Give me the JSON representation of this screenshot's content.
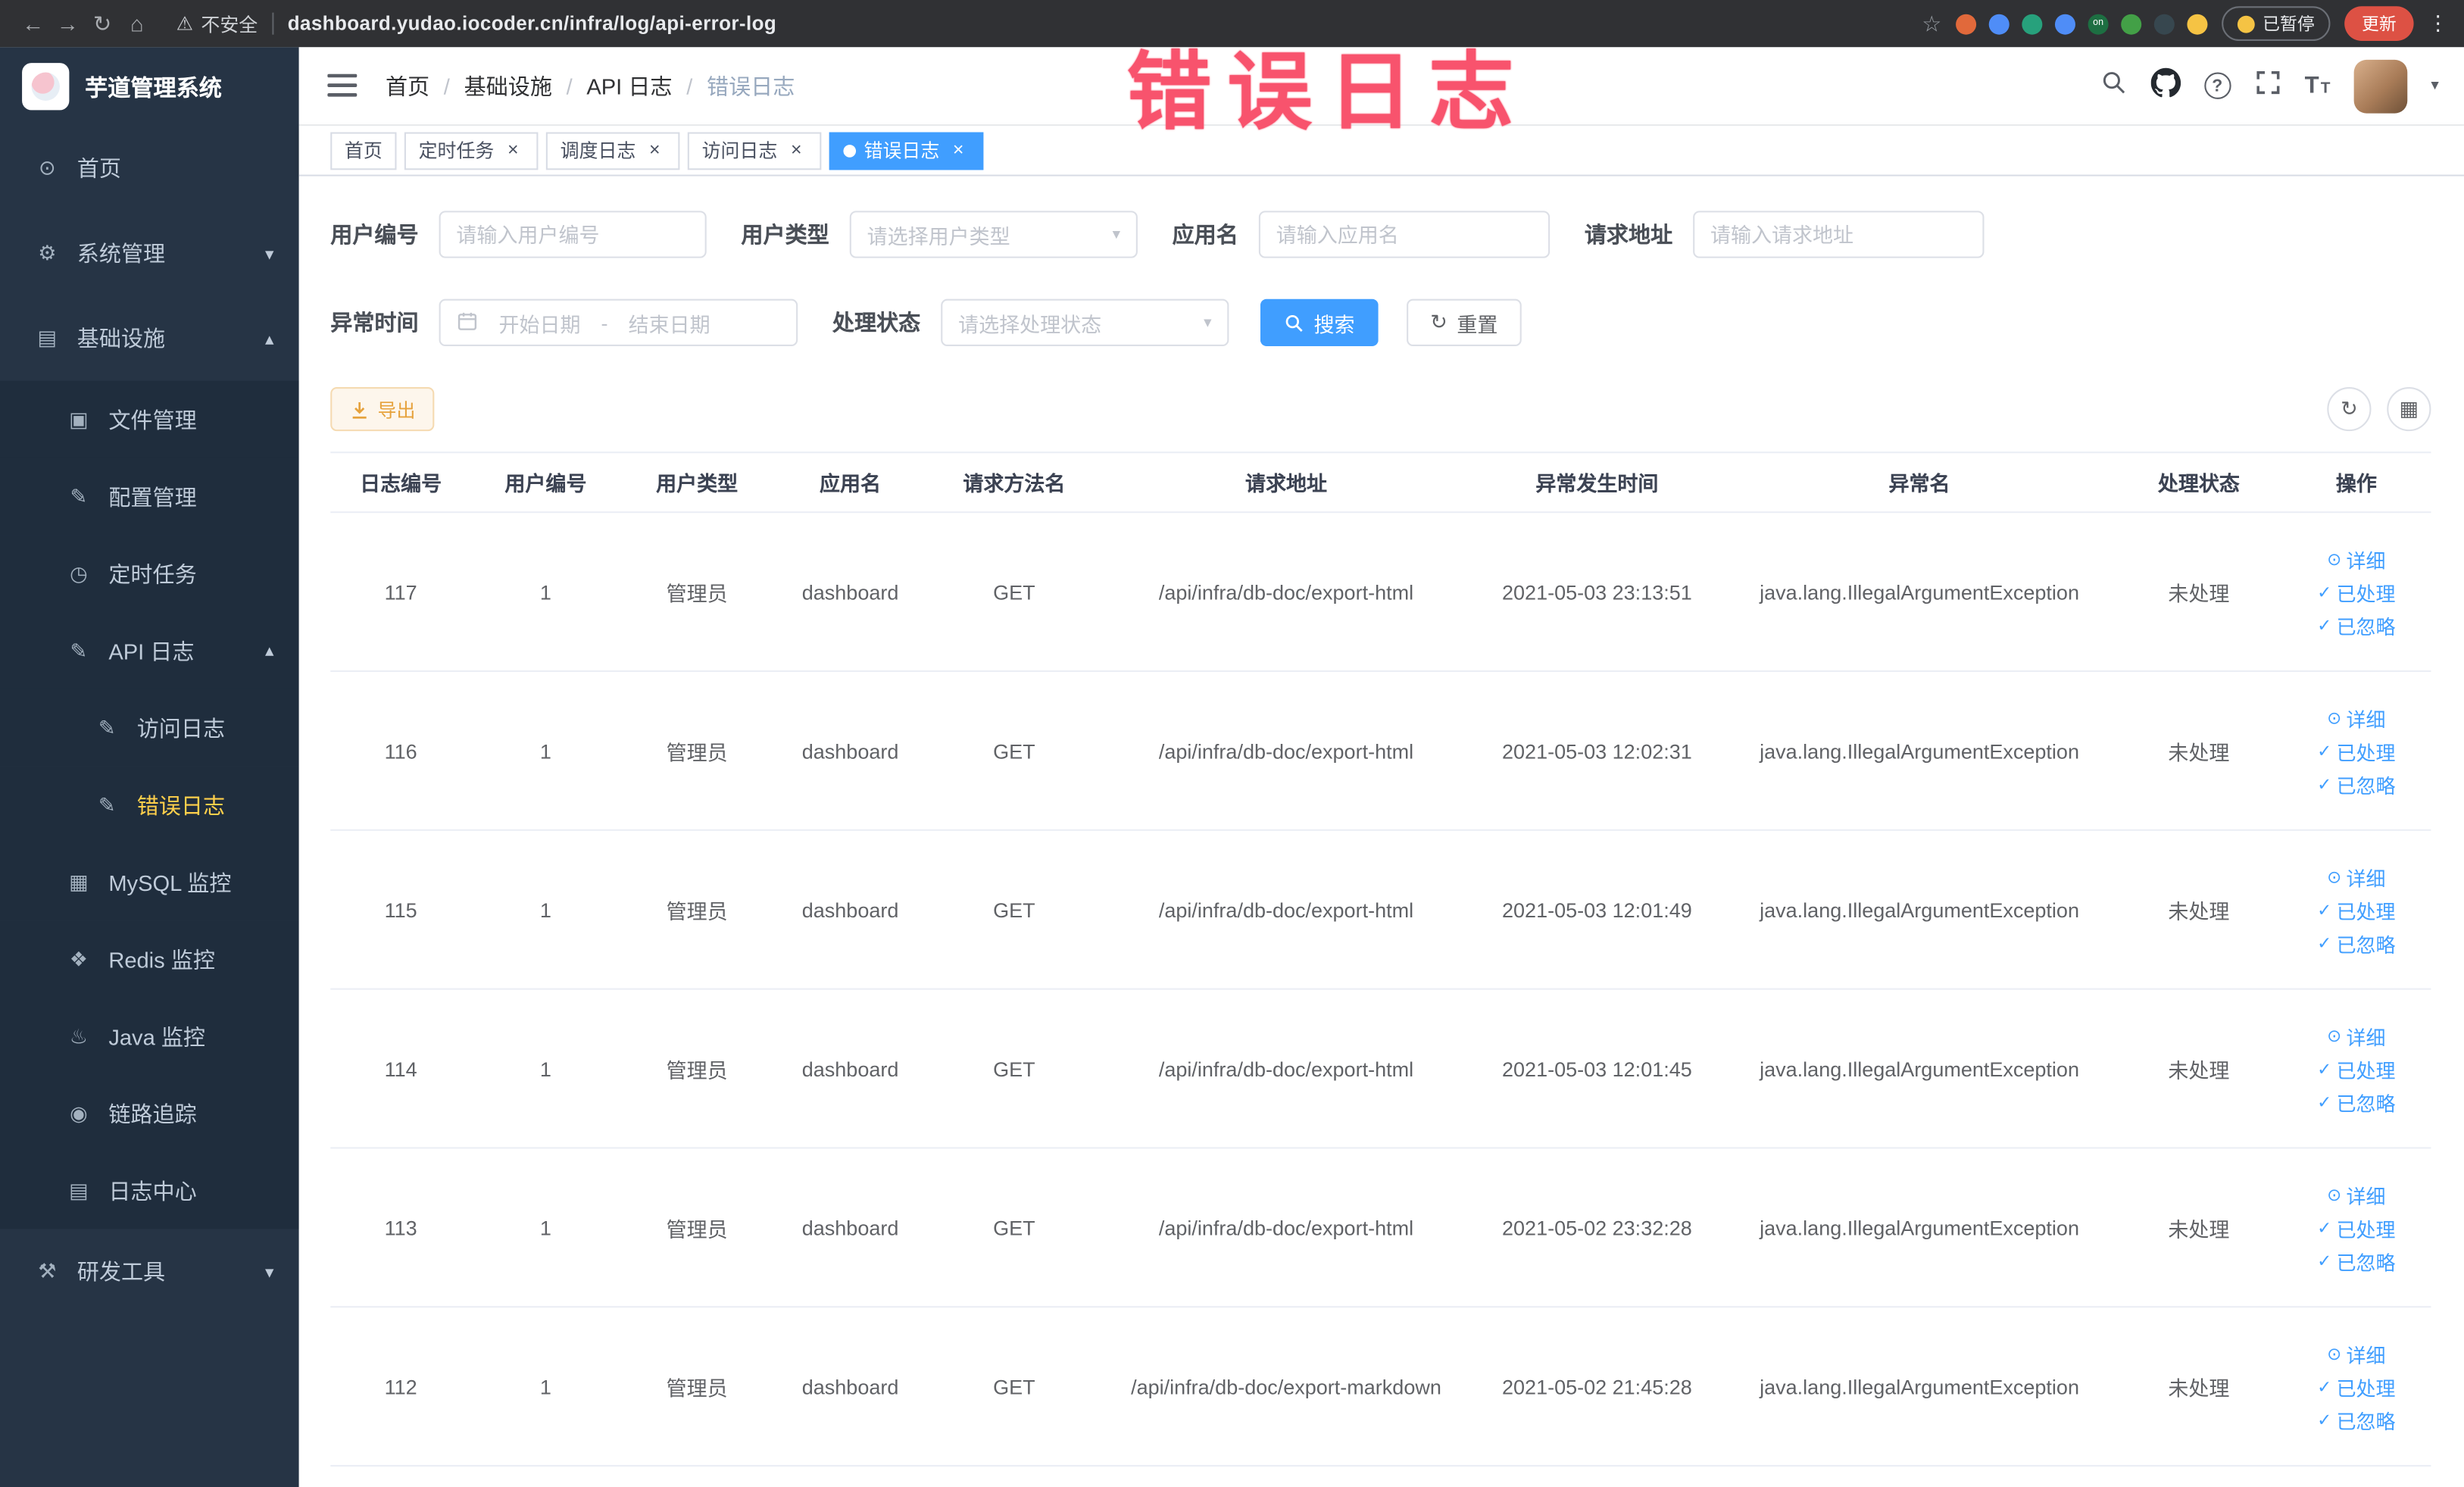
{
  "theme": {
    "accent_blue": "#409eff",
    "active_menu_gold": "#ffd04b",
    "warning_orange": "#e6a23c",
    "watermark_pink": "#f8536d"
  },
  "browser": {
    "security_label": "不安全",
    "url": "dashboard.yudao.iocoder.cn/infra/log/api-error-log",
    "paused_badge": "已暂停",
    "update_button": "更新",
    "extensions": [
      {
        "name": "extension-icon-orange",
        "color": "#e1693b"
      },
      {
        "name": "extension-icon-blue-drop",
        "color": "#4f8df7"
      },
      {
        "name": "extension-icon-green-circle",
        "color": "#27a17c"
      },
      {
        "name": "extension-icon-blue-grid",
        "color": "#4f8df7"
      },
      {
        "name": "extension-icon-on-badge",
        "color": "#1d6f42",
        "label": "on"
      },
      {
        "name": "extension-icon-sprout",
        "color": "#43a047"
      },
      {
        "name": "extension-icon-paw",
        "color": "#37474f"
      },
      {
        "name": "extension-icon-emoji",
        "color": "#f5c344"
      }
    ]
  },
  "sidebar": {
    "logo_title": "芋道管理系统",
    "items": [
      {
        "label": "首页",
        "name": "home",
        "icon": "home-icon",
        "level": 0
      },
      {
        "label": "系统管理",
        "name": "system-management",
        "icon": "gear-icon",
        "level": 0,
        "chevron": "down"
      },
      {
        "label": "基础设施",
        "name": "infrastructure",
        "icon": "infrastructure-icon",
        "level": 0,
        "chevron": "up"
      },
      {
        "label": "文件管理",
        "name": "file-management",
        "icon": "file-icon",
        "level": 1,
        "sub": true
      },
      {
        "label": "配置管理",
        "name": "config-management",
        "icon": "config-icon",
        "level": 1,
        "sub": true
      },
      {
        "label": "定时任务",
        "name": "scheduled-tasks",
        "icon": "timer-icon",
        "level": 1,
        "sub": true
      },
      {
        "label": "API 日志",
        "name": "api-log",
        "icon": "api-log-icon",
        "level": 1,
        "sub": true,
        "chevron": "up"
      },
      {
        "label": "访问日志",
        "name": "access-log",
        "icon": "access-log-icon",
        "level": 2,
        "sub": true
      },
      {
        "label": "错误日志",
        "name": "error-log",
        "icon": "error-log-icon",
        "level": 2,
        "sub": true,
        "active": true
      },
      {
        "label": "MySQL 监控",
        "name": "mysql-monitor",
        "icon": "mysql-icon",
        "level": 1,
        "sub": true
      },
      {
        "label": "Redis 监控",
        "name": "redis-monitor",
        "icon": "redis-icon",
        "level": 1,
        "sub": true
      },
      {
        "label": "Java 监控",
        "name": "java-monitor",
        "icon": "java-icon",
        "level": 1,
        "sub": true
      },
      {
        "label": "链路追踪",
        "name": "link-tracing",
        "icon": "trace-icon",
        "level": 1,
        "sub": true
      },
      {
        "label": "日志中心",
        "name": "log-center",
        "icon": "log-center-icon",
        "level": 1,
        "sub": true
      },
      {
        "label": "研发工具",
        "name": "dev-tools",
        "icon": "devtools-icon",
        "level": 0,
        "chevron": "down"
      }
    ]
  },
  "icon_glyphs": {
    "back-icon": "←",
    "forward-icon": "→",
    "reload-icon": "↻",
    "home-browser-icon": "⌂",
    "warning-icon": "⚠",
    "star-icon": "☆",
    "kebab-icon": "⋮",
    "home-icon": "⊙",
    "gear-icon": "⚙",
    "infrastructure-icon": "▤",
    "file-icon": "▣",
    "config-icon": "✎",
    "timer-icon": "◷",
    "api-log-icon": "✎",
    "access-log-icon": "✎",
    "error-log-icon": "✎",
    "mysql-icon": "▦",
    "redis-icon": "❖",
    "java-icon": "♨",
    "trace-icon": "◉",
    "log-center-icon": "▤",
    "devtools-icon": "⚒",
    "chevron-down": "▾",
    "chevron-up": "▴",
    "caret-down": "▾",
    "question-icon": "?",
    "font-size-icon": "T",
    "toolbar-refresh-icon": "↻",
    "columns-icon": "▦",
    "eye-icon": "⊙",
    "check-icon": "✓",
    "refresh-icon": "↻"
  },
  "navbar": {
    "breadcrumb": [
      "首页",
      "基础设施",
      "API 日志",
      "错误日志"
    ]
  },
  "tabs": [
    {
      "label": "首页",
      "name": "home",
      "closable": false,
      "active": false
    },
    {
      "label": "定时任务",
      "name": "scheduled-tasks",
      "closable": true,
      "active": false
    },
    {
      "label": "调度日志",
      "name": "schedule-log",
      "closable": true,
      "active": false
    },
    {
      "label": "访问日志",
      "name": "access-log",
      "closable": true,
      "active": false
    },
    {
      "label": "错误日志",
      "name": "error-log",
      "closable": true,
      "active": true
    }
  ],
  "overlay_title": "错误日志",
  "filters": {
    "user_id": {
      "label": "用户编号",
      "placeholder": "请输入用户编号"
    },
    "user_type": {
      "label": "用户类型",
      "placeholder": "请选择用户类型"
    },
    "app_name": {
      "label": "应用名",
      "placeholder": "请输入应用名"
    },
    "request_url": {
      "label": "请求地址",
      "placeholder": "请输入请求地址"
    },
    "exception_time": {
      "label": "异常时间",
      "start_placeholder": "开始日期",
      "separator": "-",
      "end_placeholder": "结束日期"
    },
    "process_status": {
      "label": "处理状态",
      "placeholder": "请选择处理状态"
    },
    "search_button": "搜索",
    "reset_button": "重置"
  },
  "toolbar": {
    "export_button": "导出"
  },
  "table": {
    "headers": [
      "日志编号",
      "用户编号",
      "用户类型",
      "应用名",
      "请求方法名",
      "请求地址",
      "异常发生时间",
      "异常名",
      "处理状态",
      "操作"
    ],
    "row_actions": [
      {
        "label": "详细",
        "name": "detail",
        "icon": "eye-icon"
      },
      {
        "label": "已处理",
        "name": "processed",
        "icon": "check-icon"
      },
      {
        "label": "已忽略",
        "name": "ignored",
        "icon": "check-icon"
      }
    ],
    "rows": [
      [
        "117",
        "1",
        "管理员",
        "dashboard",
        "GET",
        "/api/infra/db-doc/export-html",
        "2021-05-03 23:13:51",
        "java.lang.IllegalArgumentException",
        "未处理"
      ],
      [
        "116",
        "1",
        "管理员",
        "dashboard",
        "GET",
        "/api/infra/db-doc/export-html",
        "2021-05-03 12:02:31",
        "java.lang.IllegalArgumentException",
        "未处理"
      ],
      [
        "115",
        "1",
        "管理员",
        "dashboard",
        "GET",
        "/api/infra/db-doc/export-html",
        "2021-05-03 12:01:49",
        "java.lang.IllegalArgumentException",
        "未处理"
      ],
      [
        "114",
        "1",
        "管理员",
        "dashboard",
        "GET",
        "/api/infra/db-doc/export-html",
        "2021-05-03 12:01:45",
        "java.lang.IllegalArgumentException",
        "未处理"
      ],
      [
        "113",
        "1",
        "管理员",
        "dashboard",
        "GET",
        "/api/infra/db-doc/export-html",
        "2021-05-02 23:32:28",
        "java.lang.IllegalArgumentException",
        "未处理"
      ],
      [
        "112",
        "1",
        "管理员",
        "dashboard",
        "GET",
        "/api/infra/db-doc/export-markdown",
        "2021-05-02 21:45:28",
        "java.lang.IllegalArgumentException",
        "未处理"
      ]
    ]
  }
}
